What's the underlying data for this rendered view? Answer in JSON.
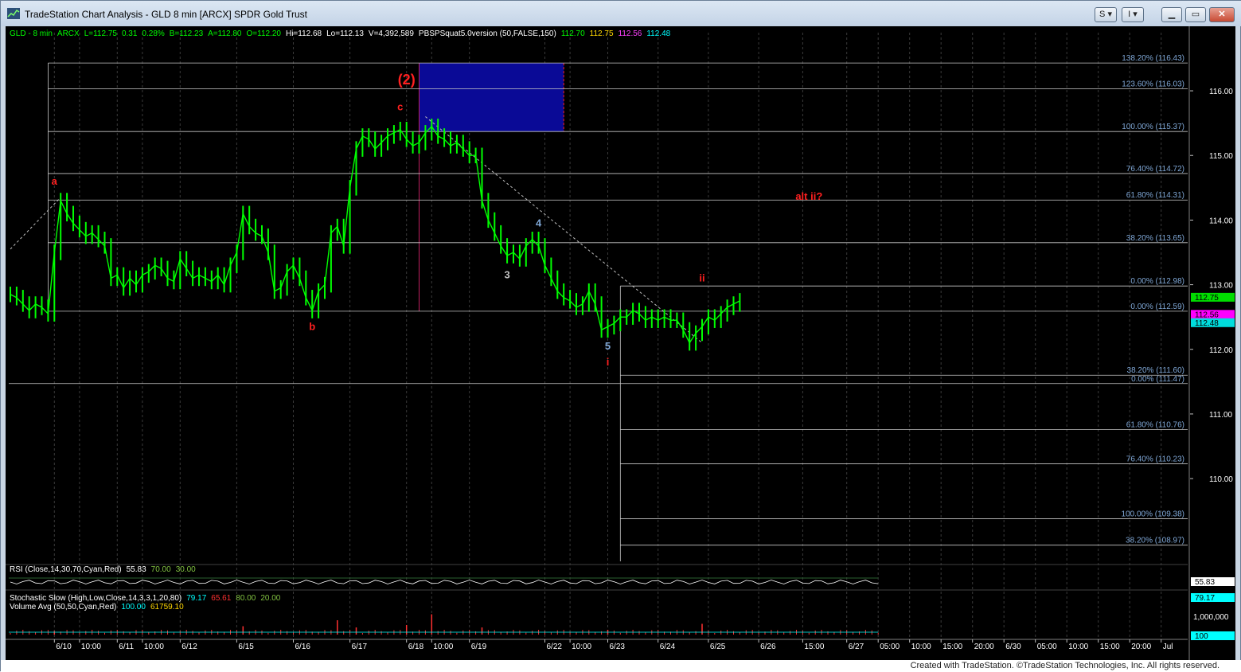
{
  "window": {
    "title": "TradeStation Chart Analysis - GLD 8 min [ARCX] SPDR Gold Trust",
    "button_s": "S",
    "button_i": "I",
    "footer": "Created with TradeStation. ©TradeStation Technologies, Inc. All rights reserved."
  },
  "colors": {
    "price": "#00ff00",
    "fib_line": "#c8c8c8",
    "fib_label": "#7fa7d6",
    "wave_label": "#ff2020",
    "box": "#0a0a96",
    "rsi_line": "#ffffff",
    "bar_up": "#00ff00",
    "cyan": "#00c8ff"
  },
  "header": {
    "symbol_line": [
      {
        "text": "GLD - 8 min",
        "color": "#00ff00"
      },
      {
        "text": "ARCX",
        "color": "#00ff00"
      },
      {
        "text": "L=112.75",
        "color": "#00ff00"
      },
      {
        "text": "0.31",
        "color": "#00ff00"
      },
      {
        "text": "0.28%",
        "color": "#00ff00"
      },
      {
        "text": "B=112.23",
        "color": "#00ff00"
      },
      {
        "text": "A=112.80",
        "color": "#00ff00"
      },
      {
        "text": "O=112.20",
        "color": "#00ff00"
      },
      {
        "text": "Hi=112.68",
        "color": "#ffffff"
      },
      {
        "text": "Lo=112.13",
        "color": "#ffffff"
      },
      {
        "text": "V=4,392,589",
        "color": "#ffffff"
      },
      {
        "text": "PBSPSquat5.0version (50,FALSE,150)",
        "color": "#ffffff"
      },
      {
        "text": "112.70",
        "color": "#00ff00"
      },
      {
        "text": "112.75",
        "color": "#ffd700"
      },
      {
        "text": "112.56",
        "color": "#ff40ff"
      },
      {
        "text": "112.48",
        "color": "#00ffff"
      }
    ]
  },
  "price_axis": {
    "range": [
      108.72,
      116.9
    ],
    "ticks": [
      "116.00",
      "115.00",
      "114.00",
      "113.00",
      "112.00",
      "111.00",
      "110.00"
    ],
    "tick_values": [
      116,
      115,
      114,
      113,
      112,
      111,
      110
    ],
    "tags": [
      {
        "text": "112.75",
        "value": 112.75,
        "bg": "#00dd00",
        "color": "#000"
      },
      {
        "text": "112.56",
        "value": 112.56,
        "bg": "#ff00ff",
        "color": "#000"
      },
      {
        "text": "112.48",
        "value": 112.48,
        "bg": "#00dddd",
        "color": "#000"
      }
    ]
  },
  "fib_levels_upper": [
    {
      "label": "138.20% (116.43)",
      "price": 116.43
    },
    {
      "label": "123.60% (116.03)",
      "price": 116.03
    },
    {
      "label": "100.00% (115.37)",
      "price": 115.37
    },
    {
      "label": "76.40% (114.72)",
      "price": 114.72
    },
    {
      "label": "61.80% (114.31)",
      "price": 114.31
    },
    {
      "label": "38.20% (113.65)",
      "price": 113.65
    },
    {
      "label": "0.00% (112.59)",
      "price": 112.59
    }
  ],
  "fib_levels_lower": [
    {
      "label": "0.00% (112.98)",
      "price": 112.98
    },
    {
      "label": "38.20% (111.60)",
      "price": 111.6
    },
    {
      "label": "0.00% (111.47)",
      "price": 111.47
    },
    {
      "label": "61.80% (110.76)",
      "price": 110.76
    },
    {
      "label": "76.40% (110.23)",
      "price": 110.23
    },
    {
      "label": "100.00% (109.38)",
      "price": 109.38
    },
    {
      "label": "38.20% (108.97)",
      "price": 108.97
    }
  ],
  "wave_labels": [
    {
      "text": "a",
      "price": 114.55,
      "bar": 7,
      "color": "#ff2020"
    },
    {
      "text": "b",
      "price": 112.3,
      "bar": 48,
      "color": "#ff2020"
    },
    {
      "text": "(2)",
      "price": 116.1,
      "bar": 63,
      "color": "#ff2020"
    },
    {
      "text": "c",
      "price": 115.7,
      "bar": 62,
      "color": "#ff2020"
    },
    {
      "text": "3",
      "price": 113.1,
      "bar": 79,
      "color": "#c0c0c0"
    },
    {
      "text": "4",
      "price": 113.9,
      "bar": 84,
      "color": "#7fa7d6"
    },
    {
      "text": "5",
      "price": 112.0,
      "bar": 95,
      "color": "#7fa7d6"
    },
    {
      "text": "i",
      "price": 111.75,
      "bar": 95,
      "color": "#ff2020"
    },
    {
      "text": "ii",
      "price": 113.05,
      "bar": 110,
      "color": "#ff2020"
    },
    {
      "text": "alt ii?",
      "price": 114.31,
      "bar": 127,
      "color": "#ff2020"
    }
  ],
  "chart_data": {
    "type": "line",
    "title": "",
    "xlabel": "",
    "ylabel": "",
    "series": [
      {
        "name": "GLD",
        "values": [
          112.85,
          112.8,
          112.7,
          112.6,
          112.7,
          112.65,
          112.55,
          113.5,
          114.3,
          114.1,
          113.95,
          113.85,
          113.75,
          113.8,
          113.7,
          113.6,
          113.1,
          113.15,
          112.95,
          113.1,
          113.0,
          113.15,
          113.2,
          113.3,
          113.25,
          113.1,
          113.05,
          113.4,
          113.25,
          113.1,
          113.15,
          113.1,
          113.05,
          113.15,
          113.0,
          113.3,
          113.5,
          114.1,
          113.9,
          113.8,
          113.75,
          113.5,
          112.9,
          112.95,
          113.2,
          113.3,
          113.1,
          112.8,
          112.6,
          112.9,
          113.0,
          113.8,
          113.9,
          113.6,
          114.5,
          115.1,
          115.3,
          115.25,
          115.1,
          115.2,
          115.3,
          115.35,
          115.4,
          115.25,
          115.15,
          115.2,
          115.35,
          115.45,
          115.3,
          115.25,
          115.15,
          115.2,
          115.1,
          115.0,
          115.0,
          114.3,
          114.0,
          113.8,
          113.6,
          113.45,
          113.5,
          113.4,
          113.6,
          113.7,
          113.6,
          113.3,
          113.1,
          112.9,
          112.8,
          112.75,
          112.65,
          112.7,
          112.9,
          112.7,
          112.3,
          112.35,
          112.4,
          112.5,
          112.5,
          112.6,
          112.55,
          112.45,
          112.5,
          112.45,
          112.5,
          112.45,
          112.45,
          112.3,
          112.1,
          112.25,
          112.35,
          112.5,
          112.45,
          112.55,
          112.65,
          112.7,
          112.75
        ]
      }
    ],
    "x_ticks": [
      "6/10",
      "10:00",
      "6/11",
      "10:00",
      "6/12",
      "6/15",
      "6/16",
      "6/17",
      "6/18",
      "10:00",
      "6/19",
      "6/22",
      "10:00",
      "6/23",
      "6/24",
      "6/25",
      "6/26",
      "15:00",
      "6/27",
      "05:00",
      "10:00",
      "15:00",
      "20:00",
      "6/30",
      "05:00",
      "10:00",
      "15:00",
      "20:00",
      "Jul"
    ],
    "x_tick_bars": [
      7,
      11,
      17,
      21,
      27,
      36,
      45,
      54,
      63,
      67,
      73,
      85,
      89,
      95,
      103,
      111,
      119,
      126,
      133,
      138,
      143,
      148,
      153,
      158,
      163,
      168,
      173,
      178,
      183
    ],
    "ylim": [
      108.72,
      116.9
    ],
    "grid": true
  },
  "indicators": {
    "rsi_label": "RSI (Close,14,30,70,Cyan,Red)",
    "rsi_values": [
      {
        "text": "55.83",
        "color": "#ffffff"
      },
      {
        "text": "70.00",
        "color": "#80c040"
      },
      {
        "text": "30.00",
        "color": "#80c040"
      }
    ],
    "rsi_tag": "55.83",
    "stoch_label": "Stochastic Slow (High,Low,Close,14,3,3,1,20,80)",
    "stoch_values": [
      {
        "text": "79.17",
        "color": "#00ffff"
      },
      {
        "text": "65.61",
        "color": "#ff3030"
      },
      {
        "text": "80.00",
        "color": "#80c040"
      },
      {
        "text": "20.00",
        "color": "#80c040"
      }
    ],
    "stoch_tag": "79.17",
    "vol_label": "Volume Avg (50,50,Cyan,Red)",
    "vol_values": [
      {
        "text": "100.00",
        "color": "#00ffff"
      },
      {
        "text": "61759.10",
        "color": "#ffd700"
      }
    ],
    "vol_axis": "1,000,000",
    "vol_tag": "100",
    "vol_spikes": [
      {
        "bar": 7,
        "level": 0.15
      },
      {
        "bar": 37,
        "level": 0.35
      },
      {
        "bar": 52,
        "level": 0.6
      },
      {
        "bar": 55,
        "level": 0.3
      },
      {
        "bar": 63,
        "level": 0.4
      },
      {
        "bar": 67,
        "level": 0.85
      },
      {
        "bar": 75,
        "level": 0.3
      },
      {
        "bar": 95,
        "level": 0.2
      },
      {
        "bar": 110,
        "level": 0.45
      }
    ]
  }
}
